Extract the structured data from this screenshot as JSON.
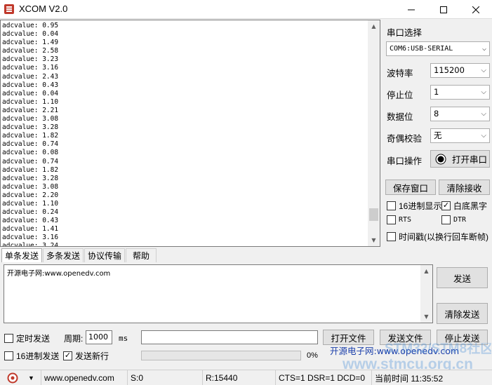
{
  "window": {
    "title": "XCOM V2.0",
    "min_icon": "minimize-icon",
    "max_icon": "maximize-icon",
    "close_icon": "close-icon"
  },
  "receive": {
    "lines": [
      "adcvalue: 0.95",
      "adcvalue: 0.04",
      "adcvalue: 1.49",
      "adcvalue: 2.58",
      "adcvalue: 3.23",
      "adcvalue: 3.16",
      "adcvalue: 2.43",
      "adcvalue: 0.43",
      "adcvalue: 0.04",
      "adcvalue: 1.10",
      "adcvalue: 2.21",
      "adcvalue: 3.08",
      "adcvalue: 3.28",
      "adcvalue: 1.82",
      "adcvalue: 0.74",
      "adcvalue: 0.08",
      "adcvalue: 0.74",
      "adcvalue: 1.82",
      "adcvalue: 3.28",
      "adcvalue: 3.08",
      "adcvalue: 2.20",
      "adcvalue: 1.10",
      "adcvalue: 0.24",
      "adcvalue: 0.43",
      "adcvalue: 1.41",
      "adcvalue: 3.16",
      "adcvalue: 3.24"
    ]
  },
  "serial": {
    "port_label": "串口选择",
    "port_value": "COM6:USB-SERIAL",
    "baud_label": "波特率",
    "baud_value": "115200",
    "stop_label": "停止位",
    "stop_value": "1",
    "data_label": "数据位",
    "data_value": "8",
    "parity_label": "奇偶校验",
    "parity_value": "无",
    "op_label": "串口操作",
    "open_button": "打开串口",
    "save_button": "保存窗口",
    "clear_rx_button": "清除接收",
    "hex_display": "16进制显示",
    "hex_display_checked": false,
    "white_black": "白底黑字",
    "white_black_checked": true,
    "rts": "RTS",
    "dtr": "DTR",
    "timestamp": "时间戳(以换行回车断帧)"
  },
  "tabs": [
    "单条发送",
    "多条发送",
    "协议传输",
    "帮助"
  ],
  "send": {
    "text": "开源电子网:www.openedv.com",
    "send_button": "发送",
    "clear_send_button": "清除发送",
    "timed_send": "定时发送",
    "period_label": "周期:",
    "period_value": "1000",
    "period_unit": "ms",
    "open_file_button": "打开文件",
    "send_file_button": "发送文件",
    "stop_send_button": "停止发送",
    "hex_send": "16进制发送",
    "newline": "发送新行",
    "newline_checked": true,
    "progress_text": "0%",
    "progress": 0
  },
  "status": {
    "website": "www.openedv.com",
    "sent": "S:0",
    "received": "R:15440",
    "signals": "CTS=1 DSR=1 DCD=0",
    "time": "当前时间 11:35:52"
  },
  "watermark": {
    "line1": "开源电子网:www.openedv.com",
    "line2": "STM32/STM8社区",
    "line3": "www.stmcu.org.cn"
  }
}
